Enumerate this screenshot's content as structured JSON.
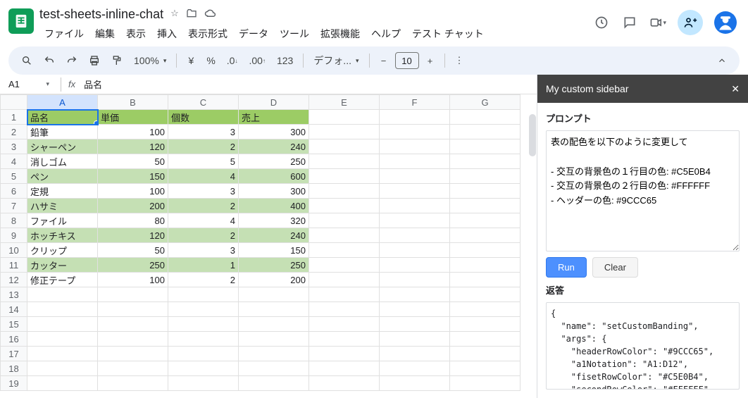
{
  "doc": {
    "title": "test-sheets-inline-chat"
  },
  "menus": [
    "ファイル",
    "編集",
    "表示",
    "挿入",
    "表示形式",
    "データ",
    "ツール",
    "拡張機能",
    "ヘルプ",
    "テスト チャット"
  ],
  "toolbar": {
    "zoom": "100%",
    "font": "デフォ...",
    "font_size": "10"
  },
  "namebox": "A1",
  "formula": "品名",
  "columns": [
    "A",
    "B",
    "C",
    "D",
    "E",
    "F",
    "G"
  ],
  "active_col": "A",
  "num_rows": 19,
  "data_cols": 4,
  "header_row": [
    "品名",
    "単価",
    "個数",
    "売上"
  ],
  "rows": [
    [
      "鉛筆",
      "100",
      "3",
      "300"
    ],
    [
      "シャーペン",
      "120",
      "2",
      "240"
    ],
    [
      "消しゴム",
      "50",
      "5",
      "250"
    ],
    [
      "ペン",
      "150",
      "4",
      "600"
    ],
    [
      "定規",
      "100",
      "3",
      "300"
    ],
    [
      "ハサミ",
      "200",
      "2",
      "400"
    ],
    [
      "ファイル",
      "80",
      "4",
      "320"
    ],
    [
      "ホッチキス",
      "120",
      "2",
      "240"
    ],
    [
      "クリップ",
      "50",
      "3",
      "150"
    ],
    [
      "カッター",
      "250",
      "1",
      "250"
    ],
    [
      "修正テープ",
      "100",
      "2",
      "200"
    ]
  ],
  "sidebar": {
    "title": "My custom sidebar",
    "prompt_label": "プロンプト",
    "prompt_text": "表の配色を以下のように変更して\n\n- 交互の背景色の１行目の色: #C5E0B4\n- 交互の背景色の２行目の色: #FFFFFF\n- ヘッダーの色: #9CCC65",
    "run_label": "Run",
    "clear_label": "Clear",
    "response_label": "返答",
    "response_text": "{\n  \"name\": \"setCustomBanding\",\n  \"args\": {\n    \"headerRowColor\": \"#9CCC65\",\n    \"a1Notation\": \"A1:D12\",\n    \"fisetRowColor\": \"#C5E0B4\",\n    \"secondRowColor\": \"#FFFFFF\"\n  }"
  }
}
